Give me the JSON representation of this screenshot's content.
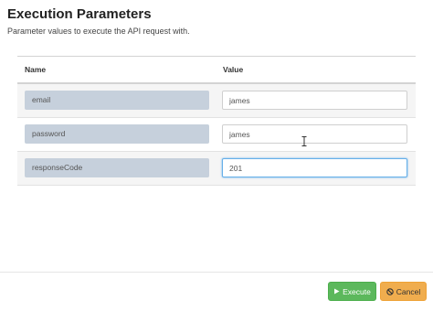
{
  "dialog": {
    "title": "Execution Parameters",
    "subtitle": "Parameter values to execute the API request with."
  },
  "table": {
    "headers": {
      "name": "Name",
      "value": "Value"
    },
    "rows": [
      {
        "name": "email",
        "value": "james"
      },
      {
        "name": "password",
        "value": "james"
      },
      {
        "name": "responseCode",
        "value": "201"
      }
    ]
  },
  "footer": {
    "execute_label": "Execute",
    "cancel_label": "Cancel"
  },
  "icons": {
    "execute": "play-icon",
    "cancel": "ban-icon"
  },
  "colors": {
    "execute": "#5cb85c",
    "cancel": "#f0ad4e",
    "name_box": "#c6d0dc",
    "focus": "#66afe9"
  }
}
